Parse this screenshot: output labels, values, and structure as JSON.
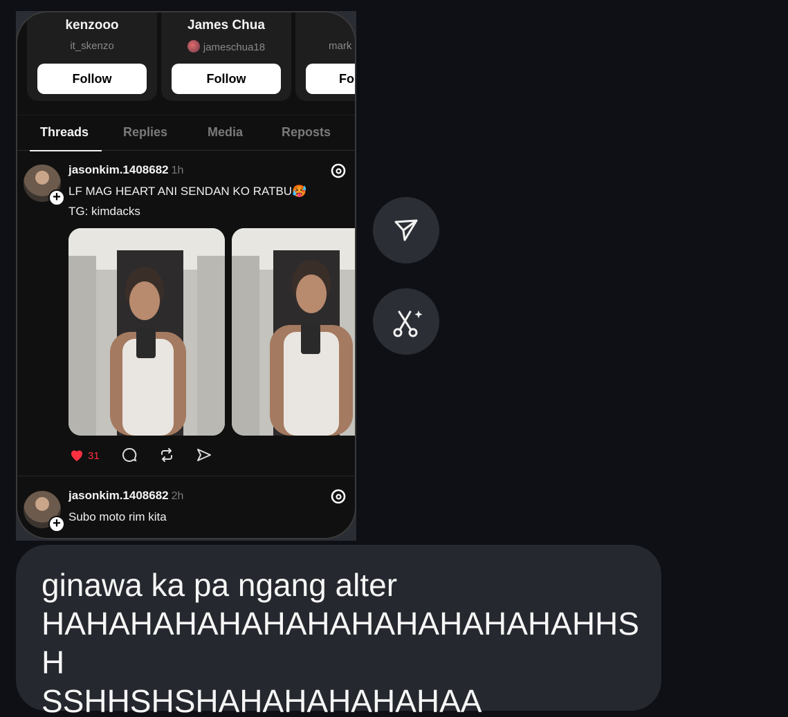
{
  "suggested": [
    {
      "name": "kenzooo",
      "handle": "it_skenzo",
      "follow_label": "Follow"
    },
    {
      "name": "James Chua",
      "handle": "jameschua18",
      "follow_label": "Follow"
    },
    {
      "name": "",
      "handle": "mark",
      "follow_label": "Fo"
    }
  ],
  "tabs": [
    "Threads",
    "Replies",
    "Media",
    "Reposts"
  ],
  "posts": [
    {
      "username": "jasonkim.1408682",
      "time": "1h",
      "text_line1": "LF MAG HEART ANI SENDAN KO RATBU🥵",
      "text_line2": "TG: kimdacks",
      "likes": "31"
    },
    {
      "username": "jasonkim.1408682",
      "time": "2h",
      "text_line1": "Subo moto rim kita"
    }
  ],
  "side_buttons": [
    "send-icon",
    "scissors-sparkle-icon"
  ],
  "message": {
    "text": "ginawa ka pa ngang alter\nHAHAHAHAHAHAHAHAHAHAHAHAHHSH\nSSHHSHSHAHAHAHAHAHAA"
  },
  "colors": {
    "background": "#0e1016",
    "bubble": "#25282e",
    "like_red": "#ff3040",
    "follow_button": "#ffffff"
  }
}
